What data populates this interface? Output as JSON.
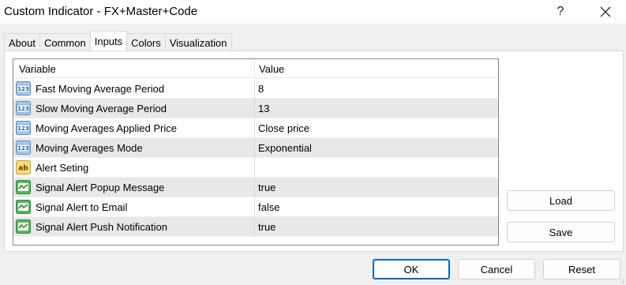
{
  "window": {
    "title": "Custom Indicator - FX+Master+Code",
    "help_label": "?"
  },
  "tabs": [
    {
      "label": "About"
    },
    {
      "label": "Common"
    },
    {
      "label": "Inputs"
    },
    {
      "label": "Colors"
    },
    {
      "label": "Visualization"
    }
  ],
  "active_tab": "Inputs",
  "grid": {
    "columns": [
      "Variable",
      "Value"
    ],
    "rows": [
      {
        "icon": "numeric-123-icon",
        "variable": "Fast Moving Average Period",
        "value": "8"
      },
      {
        "icon": "numeric-123-icon",
        "variable": "Slow Moving Average Period",
        "value": "13"
      },
      {
        "icon": "numeric-123-icon",
        "variable": "Moving Averages Applied Price",
        "value": "Close price"
      },
      {
        "icon": "numeric-123-icon",
        "variable": "Moving Averages Mode",
        "value": "Exponential"
      },
      {
        "icon": "string-ab-icon",
        "variable": "Alert Seting",
        "value": ""
      },
      {
        "icon": "boolean-check-icon",
        "variable": "Signal Alert Popup Message",
        "value": "true"
      },
      {
        "icon": "boolean-check-icon",
        "variable": "Signal Alert to Email",
        "value": "false"
      },
      {
        "icon": "boolean-check-icon",
        "variable": "Signal Alert Push Notification",
        "value": "true"
      }
    ]
  },
  "side_buttons": {
    "load": "Load",
    "save": "Save"
  },
  "footer_buttons": {
    "ok": "OK",
    "cancel": "Cancel",
    "reset": "Reset"
  },
  "colors": {
    "accent": "#0067c0",
    "numeric_icon": "#5b9bd5",
    "string_icon": "#e8c54a",
    "boolean_icon": "#3fa845",
    "alt_row": "#e8e8e8"
  }
}
